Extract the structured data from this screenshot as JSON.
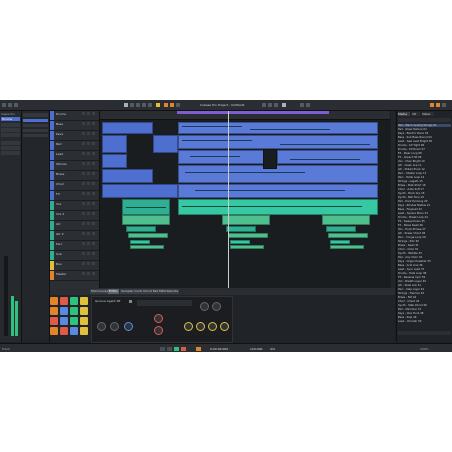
{
  "app": {
    "title": "Cubase Pro Project - Untitled1",
    "colors": {
      "accent_orange": "#e2842a",
      "range_purple": "#7d5cd6",
      "midi_blue": "#4f6fd0",
      "audio_teal": "#2fae92",
      "meter_green": "#2ec27e"
    }
  },
  "toolbar": {
    "transport_time": "0:00:00.000",
    "tempo": "120.000",
    "signature": "4/4",
    "icons": [
      "play-icon",
      "stop-icon",
      "record-icon",
      "cycle-icon",
      "metronome-icon"
    ]
  },
  "inspector": {
    "title": "Inspector",
    "track_name": "Drums"
  },
  "tracklist": {
    "tracks": [
      {
        "name": "Drums",
        "color": "#4f6fd0"
      },
      {
        "name": "Bass",
        "color": "#4f6fd0"
      },
      {
        "name": "Keys",
        "color": "#4f6fd0"
      },
      {
        "name": "Pad",
        "color": "#4f6fd0"
      },
      {
        "name": "Lead",
        "color": "#4f6fd0"
      },
      {
        "name": "Strings",
        "color": "#4f6fd0"
      },
      {
        "name": "Brass",
        "color": "#4f6fd0"
      },
      {
        "name": "Choir",
        "color": "#4f6fd0"
      },
      {
        "name": "FX",
        "color": "#4f6fd0"
      },
      {
        "name": "Vox",
        "color": "#2fae92"
      },
      {
        "name": "Vox 2",
        "color": "#2fae92"
      },
      {
        "name": "Gtr",
        "color": "#2fae92"
      },
      {
        "name": "Gtr 2",
        "color": "#2fae92"
      },
      {
        "name": "Perc",
        "color": "#2fae92"
      },
      {
        "name": "Sub",
        "color": "#2fae92"
      },
      {
        "name": "Bus",
        "color": "#e0c23a"
      },
      {
        "name": "Master",
        "color": "#e2842a"
      }
    ]
  },
  "lower_zone": {
    "tabs": [
      "MixConsole",
      "Editor",
      "Sampler Control",
      "Chord Pads",
      "MIDI Remote"
    ],
    "active_tab": "Editor",
    "instrument_name": "Groove Agent SE"
  },
  "pads": {
    "colors": [
      "#e2842a",
      "#e05a4a",
      "#2ec27e",
      "#e0c23a",
      "#e2842a",
      "#5a8ae0",
      "#2ec27e",
      "#e0c23a",
      "#e05a4a",
      "#5a8ae0",
      "#2ec27e",
      "#e0c23a",
      "#e2842a",
      "#e05a4a",
      "#5a8ae0",
      "#e0c23a"
    ]
  },
  "browser": {
    "tabs": [
      "Media",
      "CR",
      "Meter"
    ],
    "items": [
      "Pad - Warm Analog Strings 01",
      "Pad - Glass Texture 02",
      "Keys - Electric Piano 03",
      "Bass - Sub Bass Round 04",
      "Lead - Saw Lead Bright 05",
      "Drums - Kit Tight 06",
      "Drums - Kit Room 07",
      "FX - Riser Long 08",
      "FX - Impact Hit 09",
      "Vox - Chop Bright 10",
      "Gtr - Clean Arp 11",
      "Gtr - Muted Pluck 12",
      "Perc - Shaker Loop 13",
      "Perc - Tamb Loop 14",
      "Strings - Legato 15",
      "Brass - Stab Short 16",
      "Choir - Aahs Soft 17",
      "Synth - Pluck Arp 18",
      "Synth - Bell Tone 19",
      "Pad - Dark Evolving 20",
      "Keys - Rhodes Mellow 21",
      "Bass - Fingered 22",
      "Lead - Square Mono 23",
      "Drums - Break Loop 24",
      "FX - Sweep Down 25",
      "FX - Noise Swell 26",
      "Vox - Hook Phrase 27",
      "Gtr - Power Chord 28",
      "Perc - Conga Loop 29",
      "Strings - Pizz 30",
      "Brass - Swell 31",
      "Choir - Oohs 32",
      "Synth - Wobble 33",
      "Pad - Airy Choir 34",
      "Keys - Organ Drawbar 35",
      "Bass - Acid Line 36",
      "Lead - Sync Lead 37",
      "Drums - Hats Loop 38",
      "FX - Reverse Cym 39",
      "Vox - Breath Layer 40",
      "Gtr - Slide Lick 41",
      "Perc - Clap Layer 42",
      "Strings - Tremolo 43",
      "Brass - Fall 44",
      "Choir - Chant 45",
      "Synth - Stab Chord 46",
      "Pad - Shimmer 47",
      "Keys - Clav Funk 48",
      "Bass - Slap 49",
      "Lead - Vocoder 50"
    ]
  },
  "statusbar": {
    "left_label": "Track",
    "zoom": "100%"
  }
}
